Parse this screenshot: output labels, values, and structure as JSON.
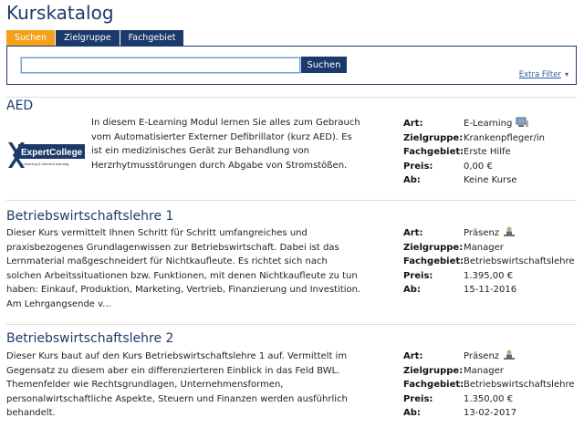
{
  "page_title": "Kurskatalog",
  "tabs": [
    {
      "label": "Suchen",
      "active": true
    },
    {
      "label": "Zielgruppe",
      "active": false
    },
    {
      "label": "Fachgebiet",
      "active": false
    }
  ],
  "search": {
    "value": "",
    "button_label": "Suchen",
    "extra_filter_label": "Extra Filter"
  },
  "labels": {
    "art": "Art:",
    "zielgruppe": "Zielgruppe:",
    "fachgebiet": "Fachgebiet:",
    "preis": "Preis:",
    "ab": "Ab:"
  },
  "colors": {
    "navy": "#1b3a6b",
    "active_tab": "#f3a219",
    "title": "#1f3a6a"
  },
  "logo": {
    "text": "ExpertCollege",
    "tagline": "e-learning & blended learning"
  },
  "courses": [
    {
      "title": "AED",
      "description": "In diesem E-Learning Modul lernen Sie alles zum Gebrauch vom Automatisierter Externer Defibrillator (kurz AED). Es ist ein medizinisches Gerät zur Behandlung von Herzrhytmusstörungen durch Abgabe von Stromstößen.",
      "art": "E-Learning",
      "art_icon": "computer-icon",
      "zielgruppe": "Krankenpfleger/in",
      "fachgebiet": "Erste Hilfe",
      "preis": "0,00 €",
      "ab": "Keine Kurse"
    },
    {
      "title": "Betriebswirtschaftslehre 1",
      "description": "Dieser Kurs vermittelt Ihnen Schritt für Schritt umfangreiches und praxisbezogenes Grundlagenwissen zur Betriebswirtschaft. Dabei ist das Lernmaterial maßgeschneidert für Nichtkaufleute. Es richtet sich nach solchen Arbeitssituationen bzw. Funktionen, mit denen Nichtkaufleute zu tun haben: Einkauf, Produktion, Marketing, Vertrieb, Finanzierung und Investition. Am Lehrgangsende v...",
      "art": "Präsenz",
      "art_icon": "classroom-icon",
      "zielgruppe": "Manager",
      "fachgebiet": "Betriebswirtschaftslehre",
      "preis": "1.395,00 €",
      "ab": "15-11-2016"
    },
    {
      "title": "Betriebswirtschaftslehre 2",
      "description": "Dieser Kurs baut auf den Kurs Betriebswirtschaftslehre 1 auf. Vermittelt im Gegensatz zu diesem aber ein differenzierteren Einblick in das Feld BWL. Themenfelder wie Rechtsgrundlagen, Unternehmensformen, personalwirtschaftliche Aspekte, Steuern und Finanzen werden ausführlich behandelt.",
      "art": "Präsenz",
      "art_icon": "classroom-icon",
      "zielgruppe": "Manager",
      "fachgebiet": "Betriebswirtschaftslehre",
      "preis": "1.350,00 €",
      "ab": "13-02-2017"
    }
  ]
}
